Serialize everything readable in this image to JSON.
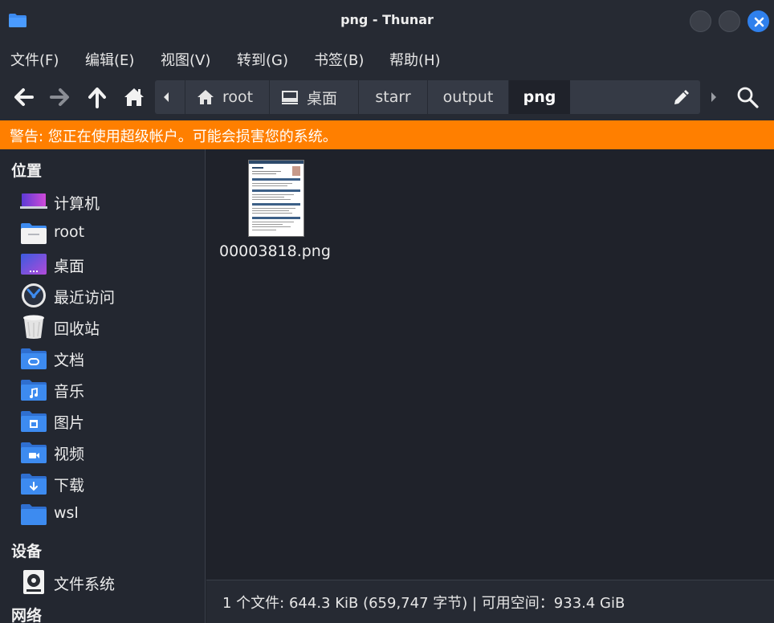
{
  "window": {
    "title": "png - Thunar",
    "accent": "#2f80ed"
  },
  "menu": [
    "文件(F)",
    "编辑(E)",
    "视图(V)",
    "转到(G)",
    "书签(B)",
    "帮助(H)"
  ],
  "toolbar": {
    "icons": [
      "back-arrow-icon",
      "forward-arrow-icon",
      "up-arrow-icon",
      "home-icon",
      "scroll-left-icon",
      "scroll-right-icon",
      "search-icon"
    ]
  },
  "breadcrumb": [
    {
      "label": "root",
      "icon": "home-icon"
    },
    {
      "label": "桌面",
      "icon": "desktop-icon"
    },
    {
      "label": "starr"
    },
    {
      "label": "output"
    },
    {
      "label": "png",
      "active": true
    }
  ],
  "warning": {
    "text": "警告: 您正在使用超级帐户。可能会损害您的系统。",
    "color": "#ff7f00"
  },
  "sidebar": {
    "places_title": "位置",
    "places": [
      {
        "label": "计算机",
        "icon": "computer-icon"
      },
      {
        "label": "root",
        "icon": "home-folder-icon"
      },
      {
        "label": "桌面",
        "icon": "desktop-icon"
      },
      {
        "label": "最近访问",
        "icon": "recent-clock-icon"
      },
      {
        "label": "回收站",
        "icon": "trash-icon"
      },
      {
        "label": "文档",
        "icon": "documents-folder-icon"
      },
      {
        "label": "音乐",
        "icon": "music-folder-icon"
      },
      {
        "label": "图片",
        "icon": "pictures-folder-icon"
      },
      {
        "label": "视频",
        "icon": "videos-folder-icon"
      },
      {
        "label": "下载",
        "icon": "downloads-folder-icon"
      },
      {
        "label": "wsl",
        "icon": "folder-icon"
      }
    ],
    "devices_title": "设备",
    "devices": [
      {
        "label": "文件系统",
        "icon": "drive-icon"
      }
    ],
    "network_title": "网络"
  },
  "files": [
    {
      "name": "00003818.png",
      "icon": "image-thumbnail-icon"
    }
  ],
  "status": {
    "text": "1 个文件: 644.3 KiB (659,747 字节) | 可用空间：933.4 GiB"
  }
}
